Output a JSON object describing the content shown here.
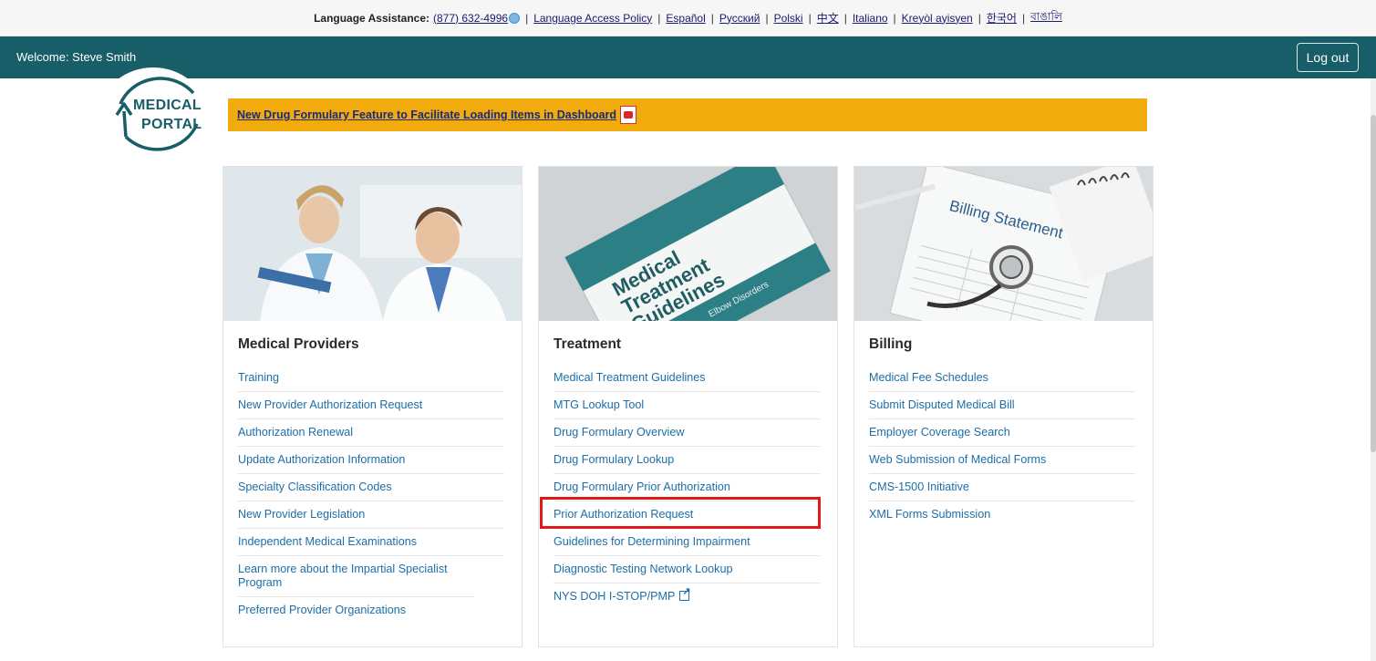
{
  "lang_bar": {
    "label": "Language Assistance:",
    "phone": "(877) 632-4996",
    "links": [
      "Language Access Policy",
      "Español",
      "Русский",
      "Polski",
      "中文",
      "Italiano",
      "Kreyòl ayisyen",
      "한국어",
      "বাঙালি"
    ]
  },
  "header": {
    "welcome": "Welcome: Steve Smith",
    "logout_label": "Log out"
  },
  "logo": {
    "line1": "MEDICAL",
    "line2": "PORTAL"
  },
  "announcement": {
    "text": "New Drug Formulary Feature to Facilitate Loading Items in Dashboard"
  },
  "cards": [
    {
      "title": "Medical Providers",
      "items": [
        "Training",
        "New Provider Authorization Request",
        "Authorization Renewal",
        "Update Authorization Information",
        "Specialty Classification Codes",
        "New Provider Legislation",
        "Independent Medical Examinations",
        "Learn more about the Impartial Specialist Program",
        "Preferred Provider Organizations"
      ]
    },
    {
      "title": "Treatment",
      "image_text": {
        "line1": "Medical",
        "line2": "Treatment",
        "line3": "Guidelines",
        "sub": "Elbow Disorders"
      },
      "items": [
        "Medical Treatment Guidelines",
        "MTG Lookup Tool",
        "Drug Formulary Overview",
        "Drug Formulary Lookup",
        "Drug Formulary Prior Authorization",
        "Prior Authorization Request",
        "Guidelines for Determining Impairment",
        "Diagnostic Testing Network Lookup",
        "NYS DOH I-STOP/PMP"
      ]
    },
    {
      "title": "Billing",
      "image_text": {
        "title": "Billing Statement"
      },
      "items": [
        "Medical Fee Schedules",
        "Submit Disputed Medical Bill",
        "Employer Coverage Search",
        "Web Submission of Medical Forms",
        "CMS-1500 Initiative",
        "XML Forms Submission"
      ]
    }
  ],
  "colors": {
    "header": "#175e68",
    "announcement": "#f2ab0c",
    "link": "#1c6ea8",
    "highlight": "#e01818"
  }
}
